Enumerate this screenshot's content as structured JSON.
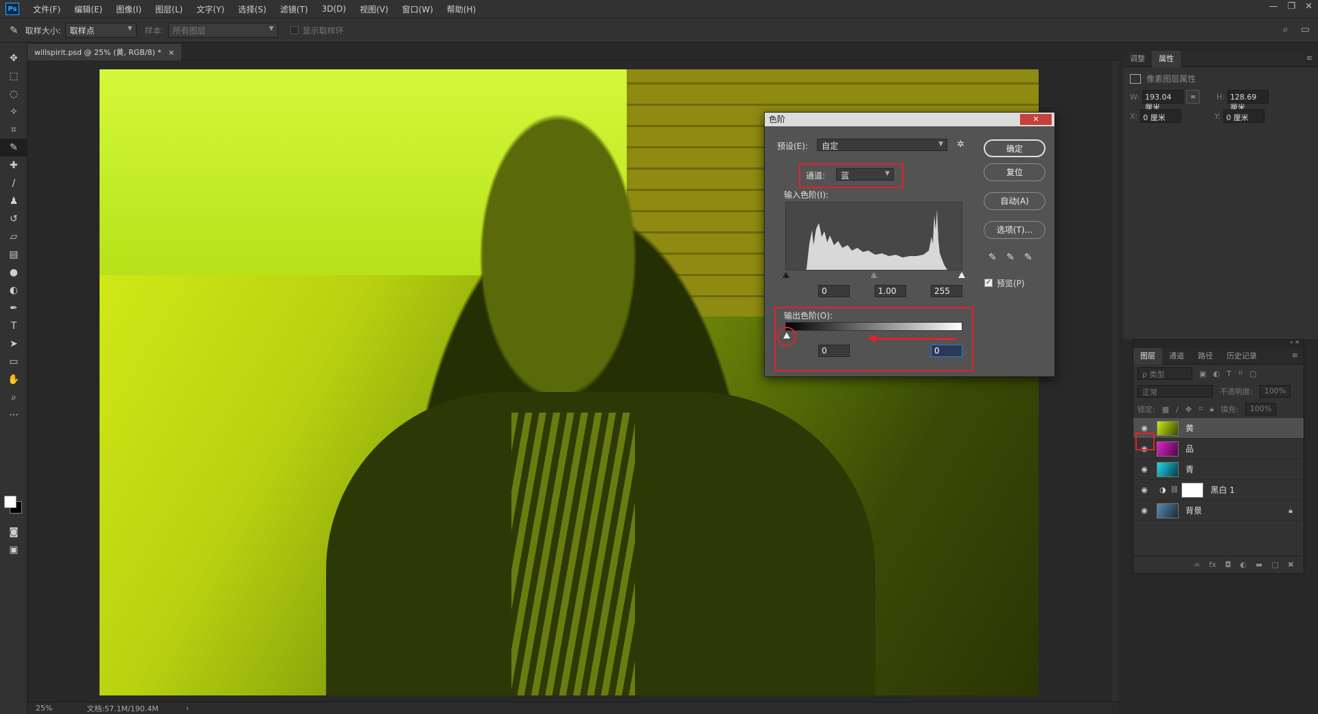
{
  "menubar": {
    "logo": "Ps",
    "items": [
      "文件(F)",
      "编辑(E)",
      "图像(I)",
      "图层(L)",
      "文字(Y)",
      "选择(S)",
      "滤镜(T)",
      "3D(D)",
      "视图(V)",
      "窗口(W)",
      "帮助(H)"
    ],
    "window_controls": [
      "—",
      "❐",
      "✕"
    ]
  },
  "options": {
    "sample_size_label": "取样大小:",
    "sample_size_value": "取样点",
    "sample_label": "样本:",
    "sample_value": "所有图层",
    "show_ring_label": "显示取样环"
  },
  "doc_tab": {
    "title": "willspirit.psd @ 25% (黄, RGB/8) *",
    "close": "×"
  },
  "status": {
    "zoom": "25%",
    "doc_info": "文档:57.1M/190.4M",
    "arrow": "›"
  },
  "properties": {
    "tabs": [
      "调整",
      "属性"
    ],
    "title": "像素图层属性",
    "w_label": "W:",
    "w_value": "193.04 厘米",
    "h_label": "H:",
    "h_value": "128.69 厘米",
    "x_label": "X:",
    "x_value": "0 厘米",
    "y_label": "Y:",
    "y_value": "0 厘米"
  },
  "layers": {
    "tabs": [
      "图层",
      "通道",
      "路径",
      "历史记录"
    ],
    "filter_placeholder": "ρ 类型",
    "blend_mode": "正常",
    "opacity_label": "不透明度:",
    "opacity_value": "100%",
    "lock_label": "锁定:",
    "fill_label": "填充:",
    "fill_value": "100%",
    "items": [
      {
        "name": "黄",
        "selected": true
      },
      {
        "name": "品",
        "selected": false
      },
      {
        "name": "青",
        "selected": false
      },
      {
        "name": "黑白 1",
        "selected": false
      },
      {
        "name": "背景",
        "selected": false
      }
    ]
  },
  "levels_dialog": {
    "title": "色阶",
    "preset_label": "预设(E):",
    "preset_value": "自定",
    "channel_label": "通道:",
    "channel_value": "蓝",
    "input_label": "输入色阶(I):",
    "input_black": "0",
    "input_gamma": "1.00",
    "input_white": "255",
    "output_label": "输出色阶(O):",
    "output_black": "0",
    "output_white": "0",
    "buttons": {
      "ok": "确定",
      "reset": "复位",
      "auto": "自动(A)",
      "options": "选项(T)..."
    },
    "preview_label": "预览(P)",
    "preview_checked": true
  },
  "colors": {
    "accent_red": "#e8202a",
    "dialog_bg": "#535353",
    "panel_bg": "#323232"
  }
}
